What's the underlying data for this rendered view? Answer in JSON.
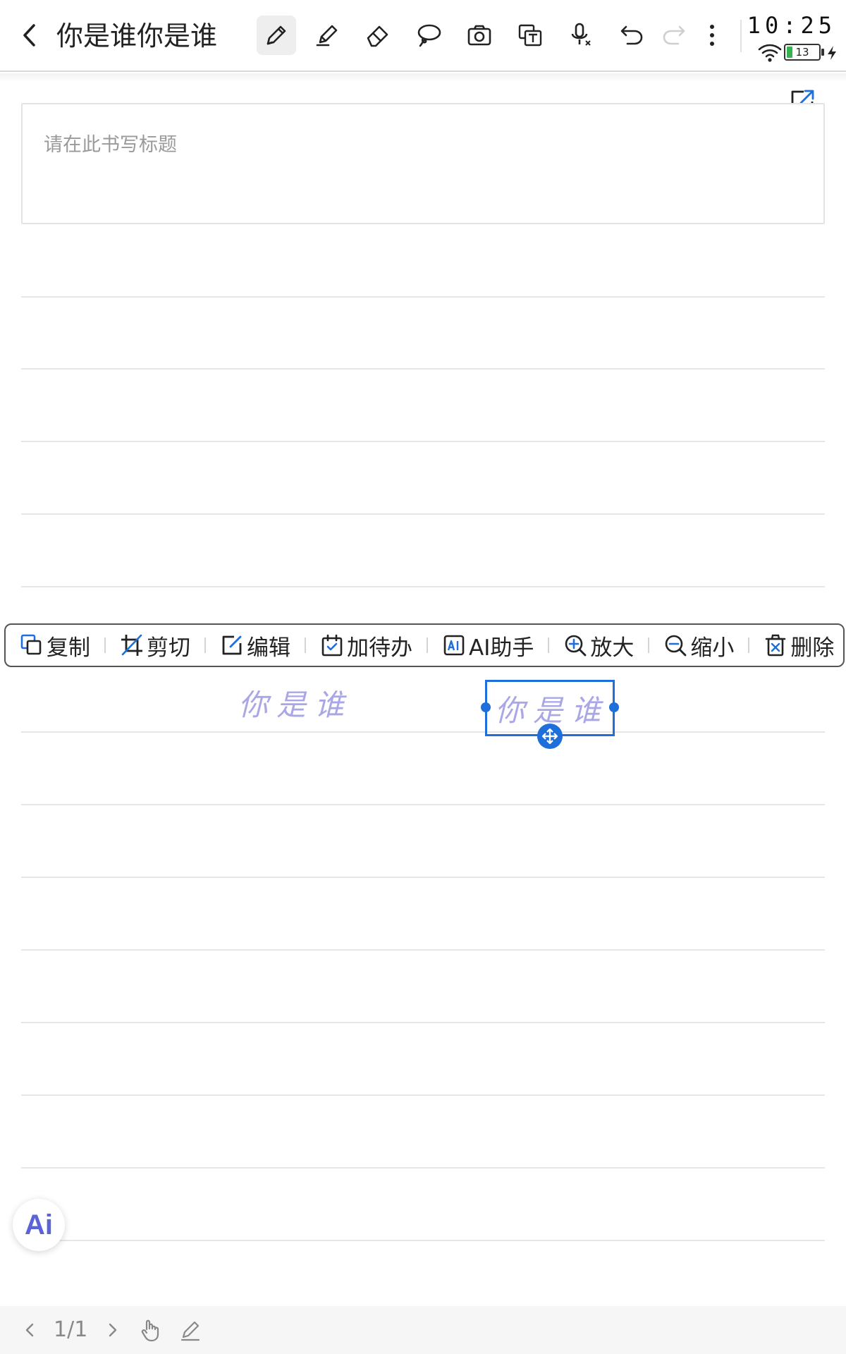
{
  "header": {
    "title": "你是谁你是谁",
    "tools": [
      {
        "name": "pen",
        "active": true
      },
      {
        "name": "highlighter"
      },
      {
        "name": "eraser"
      },
      {
        "name": "lasso"
      },
      {
        "name": "camera"
      },
      {
        "name": "text-recognition"
      },
      {
        "name": "voice"
      },
      {
        "name": "undo"
      },
      {
        "name": "redo",
        "disabled": true
      },
      {
        "name": "more"
      }
    ]
  },
  "status": {
    "time": "10:25",
    "battery": "13"
  },
  "note": {
    "title_placeholder": "请在此书写标题"
  },
  "context_menu": {
    "items": [
      {
        "icon": "copy-icon",
        "label": "复制"
      },
      {
        "icon": "crop-icon",
        "label": "剪切"
      },
      {
        "icon": "edit-icon",
        "label": "编辑"
      },
      {
        "icon": "todo-icon",
        "label": "加待办"
      },
      {
        "icon": "ai-icon",
        "label": "AI助手"
      },
      {
        "icon": "zoom-in-icon",
        "label": "放大"
      },
      {
        "icon": "zoom-out-icon",
        "label": "缩小"
      },
      {
        "icon": "delete-icon",
        "label": "删除"
      }
    ]
  },
  "handwriting": {
    "left_text": "你是谁",
    "selected_text": "你是谁",
    "ink_color": "#a9a7e6",
    "selection_color": "#1e6fd9"
  },
  "ai_button": {
    "label": "Ai"
  },
  "footer": {
    "page_indicator": "1/1"
  }
}
